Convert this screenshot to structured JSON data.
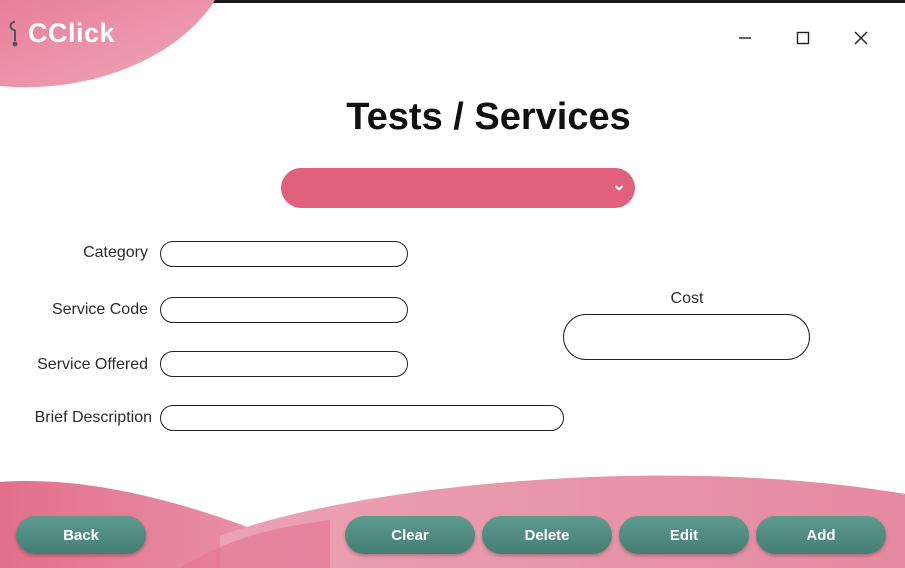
{
  "app": {
    "logo_text": "CClick",
    "title": "Tests / Services"
  },
  "window_controls": {
    "minimize": "minimize-icon",
    "maximize": "maximize-icon",
    "close": "close-icon"
  },
  "service_select": {
    "value": "",
    "icon": "chevron-down-icon"
  },
  "form": {
    "category_label": "Category",
    "category_value": "",
    "service_code_label": "Service Code",
    "service_code_value": "",
    "service_offered_label": "Service Offered",
    "service_offered_value": "",
    "brief_description_label": "Brief Description",
    "brief_description_value": "",
    "cost_label": "Cost",
    "cost_value": ""
  },
  "buttons": {
    "back": "Back",
    "clear": "Clear",
    "delete": "Delete",
    "edit": "Edit",
    "add": "Add"
  },
  "colors": {
    "accent_pink": "#e0607e",
    "wave_pink": "#e88aa0",
    "button_teal": "#4f8a80"
  }
}
